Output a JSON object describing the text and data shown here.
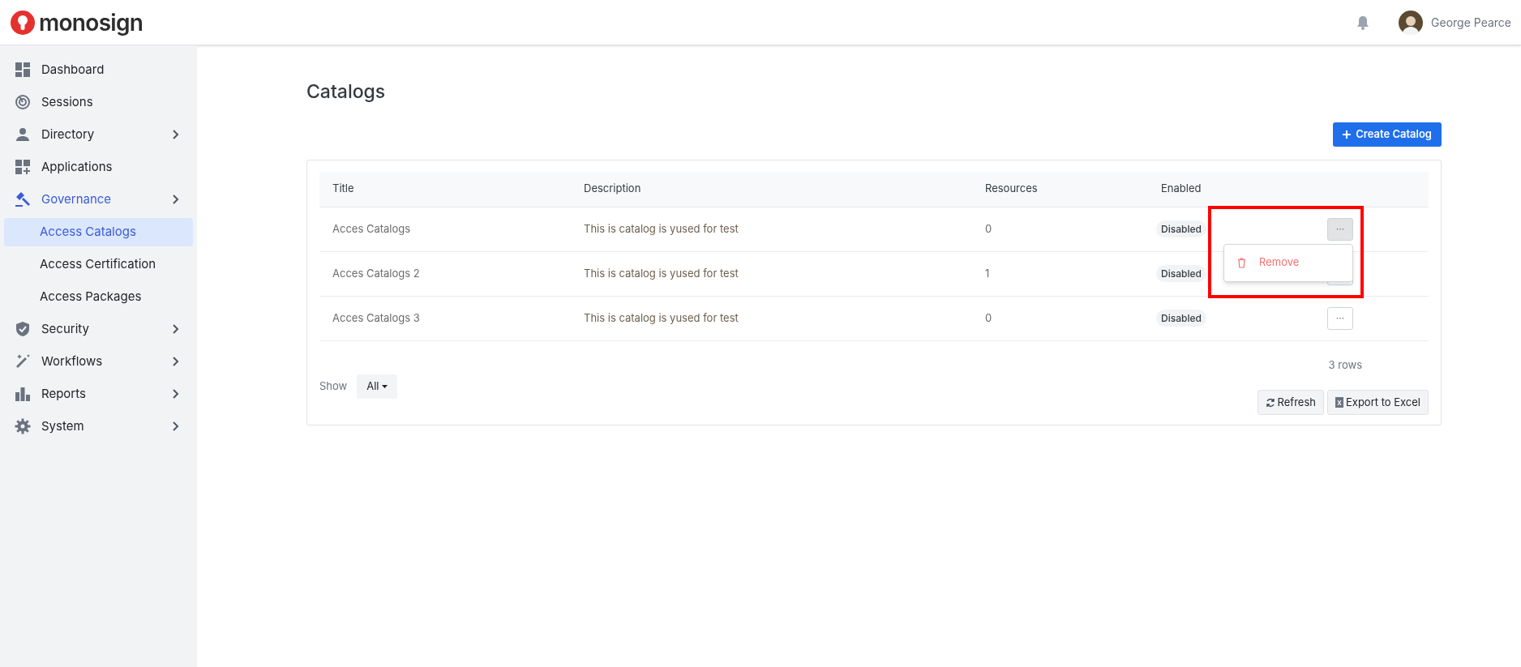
{
  "brand": {
    "name": "monosign"
  },
  "header": {
    "user": "George Pearce"
  },
  "sidebar": {
    "items": [
      {
        "label": "Dashboard",
        "has_submenu": false,
        "selected": false
      },
      {
        "label": "Sessions",
        "has_submenu": false,
        "selected": false
      },
      {
        "label": "Directory",
        "has_submenu": true,
        "selected": false
      },
      {
        "label": "Applications",
        "has_submenu": false,
        "selected": false
      },
      {
        "label": "Governance",
        "has_submenu": true,
        "selected": true,
        "children": [
          {
            "label": "Access Catalogs",
            "selected": true
          },
          {
            "label": "Access Certification",
            "selected": false
          },
          {
            "label": "Access Packages",
            "selected": false
          }
        ]
      },
      {
        "label": "Security",
        "has_submenu": true,
        "selected": false
      },
      {
        "label": "Workflows",
        "has_submenu": true,
        "selected": false
      },
      {
        "label": "Reports",
        "has_submenu": true,
        "selected": false
      },
      {
        "label": "System",
        "has_submenu": true,
        "selected": false
      }
    ]
  },
  "page": {
    "title": "Catalogs",
    "create_button": "Create Catalog"
  },
  "table": {
    "columns": [
      "Title",
      "Description",
      "Resources",
      "Enabled"
    ],
    "rows": [
      {
        "title": "Acces Catalogs",
        "description": "This is catalog is yused for test",
        "resources": "0",
        "enabled": "Disabled",
        "actions": "···",
        "menu_open": true,
        "menu": [
          "Remove"
        ]
      },
      {
        "title": "Acces Catalogs 2",
        "description": "This is catalog is yused for test",
        "resources": "1",
        "enabled": "Disabled",
        "menu_open": false
      },
      {
        "title": "Acces Catalogs 3",
        "description": "This is catalog is yused for test",
        "resources": "0",
        "enabled": "Disabled",
        "actions": "···",
        "menu_open": false
      }
    ]
  },
  "footer": {
    "show_label": "Show",
    "show_value": "All",
    "row_count": "3 rows",
    "refresh": "Refresh",
    "export": "Export to Excel"
  }
}
